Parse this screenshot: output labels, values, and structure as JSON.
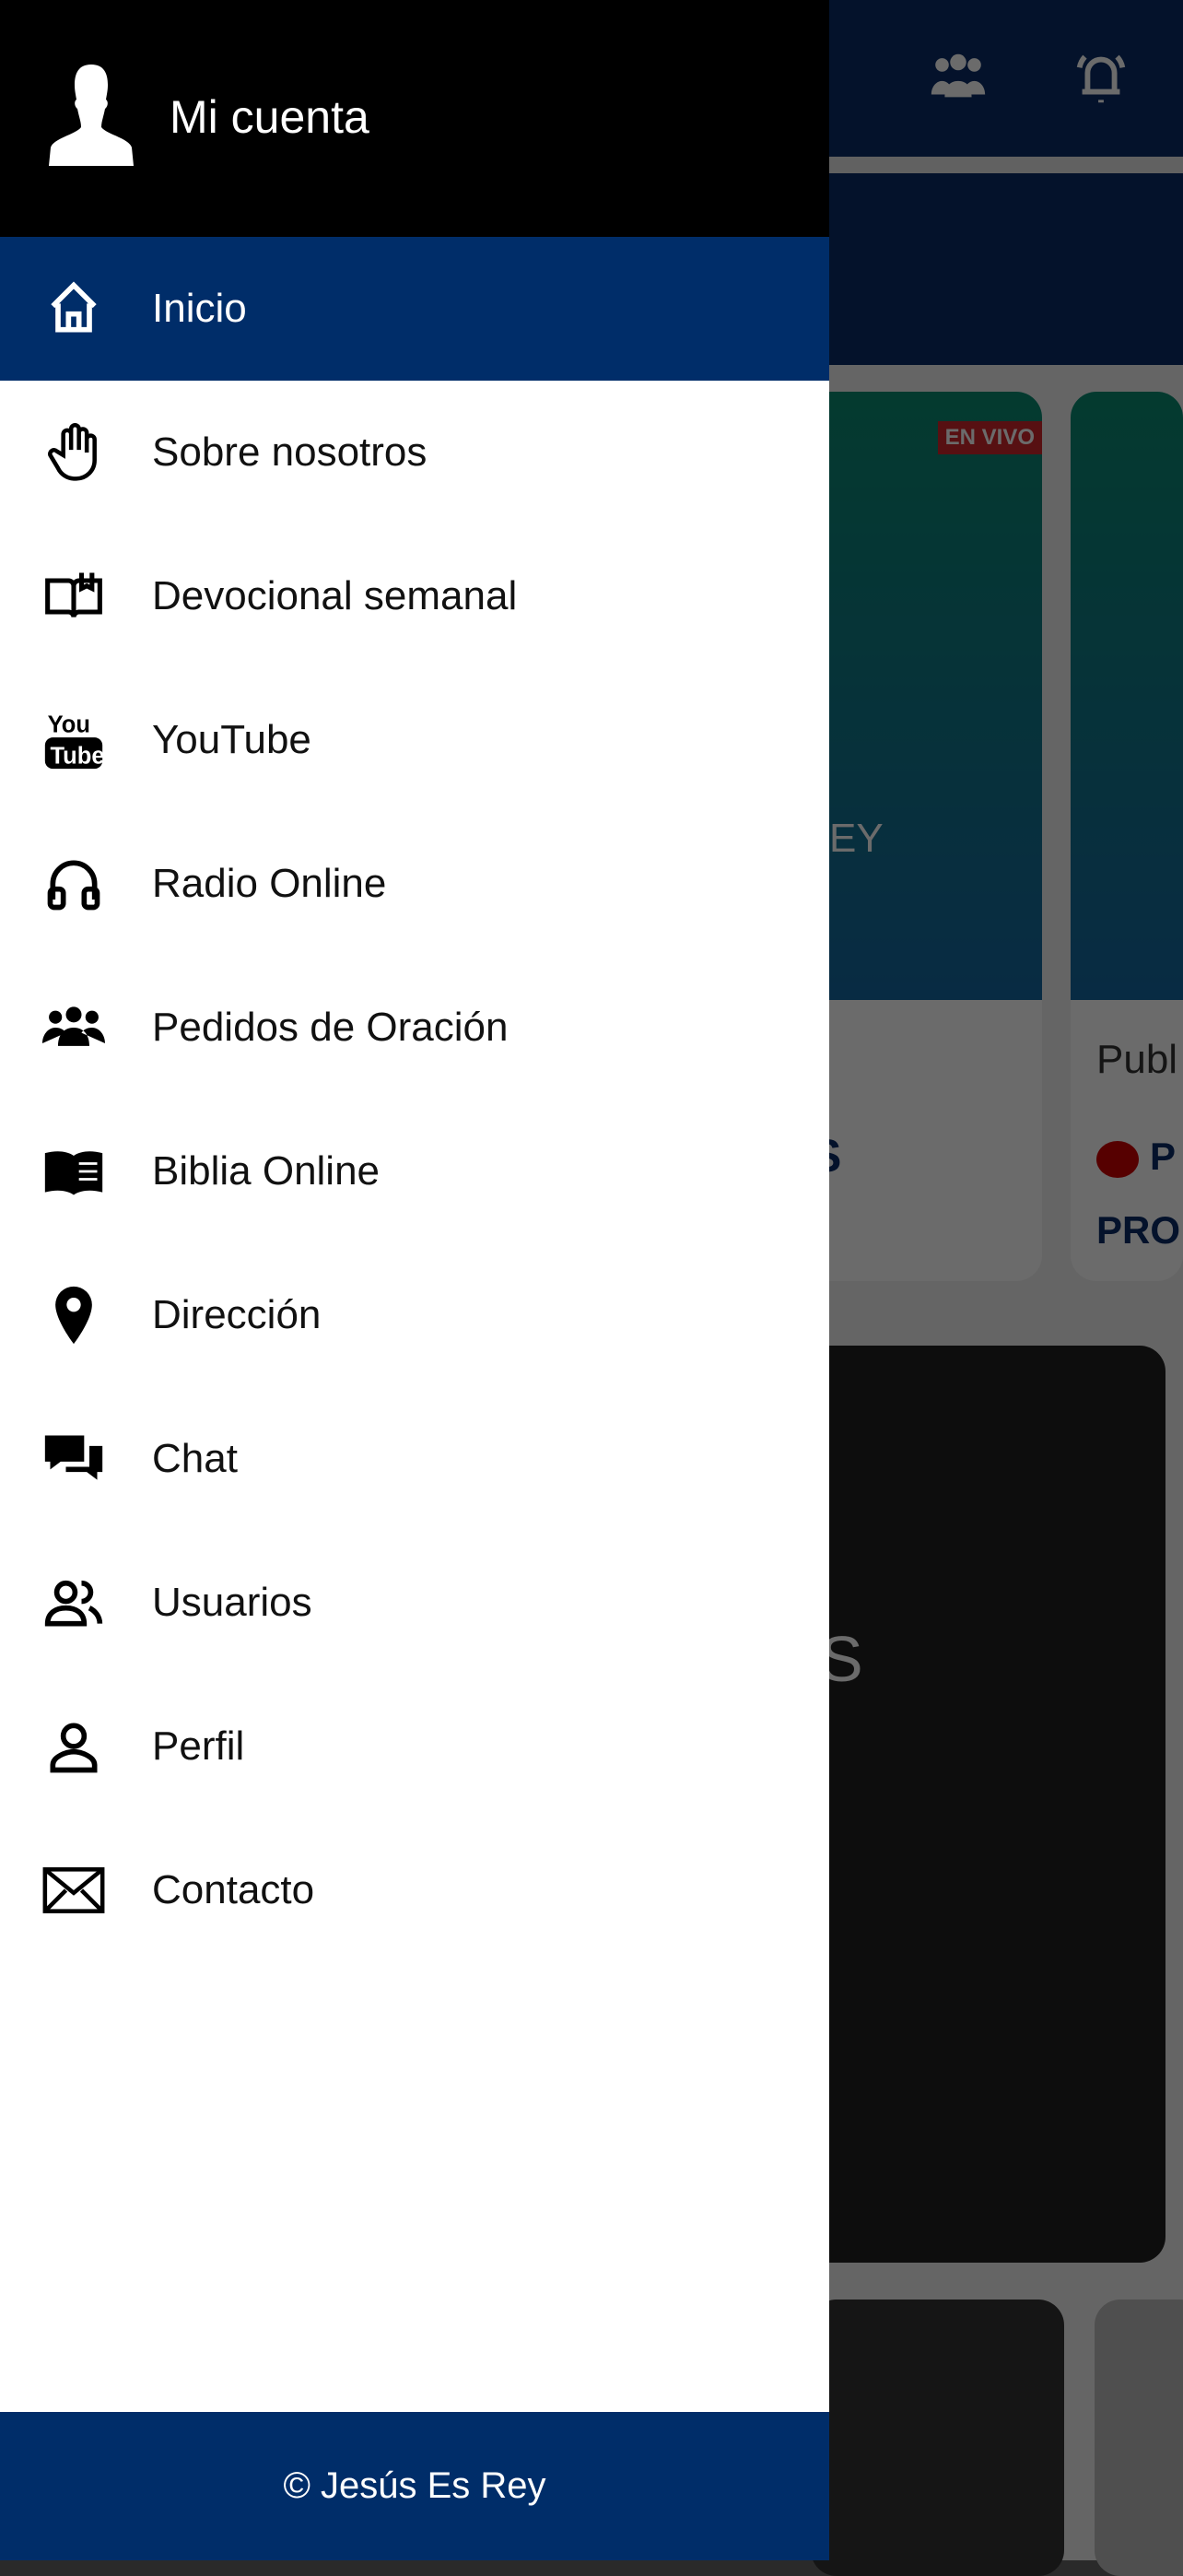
{
  "colors": {
    "primary": "#002d69",
    "header": "#000000",
    "live": "#d0262c"
  },
  "drawer": {
    "account_label": "Mi cuenta",
    "items": [
      {
        "label": "Inicio",
        "icon": "home-icon",
        "active": true
      },
      {
        "label": "Sobre nosotros",
        "icon": "hand-icon"
      },
      {
        "label": "Devocional semanal",
        "icon": "book-open-icon"
      },
      {
        "label": "YouTube",
        "icon": "youtube-icon"
      },
      {
        "label": "Radio Online",
        "icon": "headphones-icon"
      },
      {
        "label": "Pedidos de Oración",
        "icon": "group-icon"
      },
      {
        "label": "Biblia Online",
        "icon": "bible-icon"
      },
      {
        "label": "Dirección",
        "icon": "map-pin-icon"
      },
      {
        "label": "Chat",
        "icon": "chat-icon"
      },
      {
        "label": "Usuarios",
        "icon": "users-icon"
      },
      {
        "label": "Perfil",
        "icon": "person-icon"
      },
      {
        "label": "Contacto",
        "icon": "envelope-icon"
      }
    ],
    "footer": "© Jesús Es Rey"
  },
  "background": {
    "live_badge": "EN VIVO",
    "card_logo_partial": "EY",
    "card1_text_partial": "S",
    "card2_label_partial": "Publ",
    "card2_title_partial1": "P",
    "card2_title_partial2": "PRO",
    "dark_card_text_partial": "S"
  }
}
